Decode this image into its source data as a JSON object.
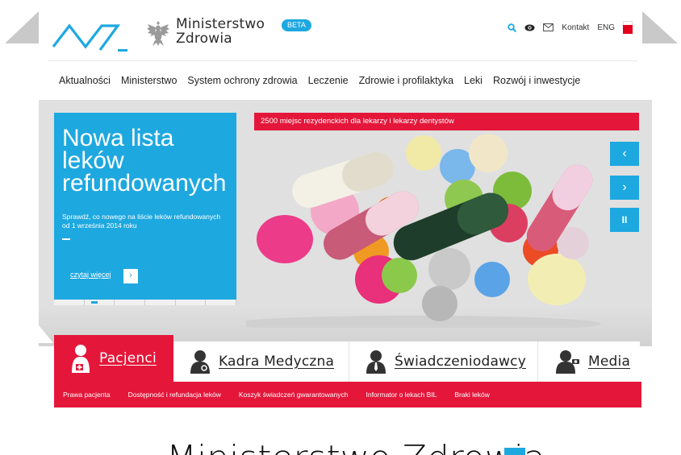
{
  "header": {
    "brand_line1": "Ministerstwo",
    "brand_line2": "Zdrowia",
    "beta_label": "BETA",
    "icons": [
      "search-icon",
      "eye-icon",
      "mail-icon"
    ],
    "contact_label": "Kontakt",
    "lang_label": "ENG"
  },
  "nav": {
    "items": [
      "Aktualności",
      "Ministerstwo",
      "System ochrony zdrowia",
      "Leczenie",
      "Zdrowie i profilaktyka",
      "Leki",
      "Rozwój i inwestycje"
    ]
  },
  "hero": {
    "news_strip": "2500 miejsc rezydenckich dla lekarzy i lekarzy dentystów",
    "title": "Nowa lista leków refundowanych",
    "description": "Sprawdź, co nowego na liście leków refundowanych od 1 września 2014 roku",
    "read_more": "czytaj więcej",
    "read_more_arrow": "›",
    "controls": {
      "prev": "‹",
      "next": "›",
      "pause": "II"
    },
    "slider_segments": 6,
    "active_slide": 1
  },
  "categories": {
    "items": [
      {
        "label": "Pacjenci",
        "icon": "patient-icon",
        "active": true
      },
      {
        "label": "Kadra Medyczna",
        "icon": "doctor-icon",
        "active": false
      },
      {
        "label": "Świadczeniodawcy",
        "icon": "provider-icon",
        "active": false
      },
      {
        "label": "Media",
        "icon": "media-icon",
        "active": false
      }
    ]
  },
  "subnav": {
    "items": [
      "Prawa pacjenta",
      "Dostępność i refundacja leków",
      "Koszyk świadczeń gwarantowanych",
      "Informator o lekach BIL",
      "Braki leków"
    ]
  },
  "footer_title": "Ministerstwo Zdrowia",
  "colors": {
    "accent_blue": "#1ea8e0",
    "accent_red": "#e4173a",
    "hero_gray": "#e0e0e0"
  }
}
